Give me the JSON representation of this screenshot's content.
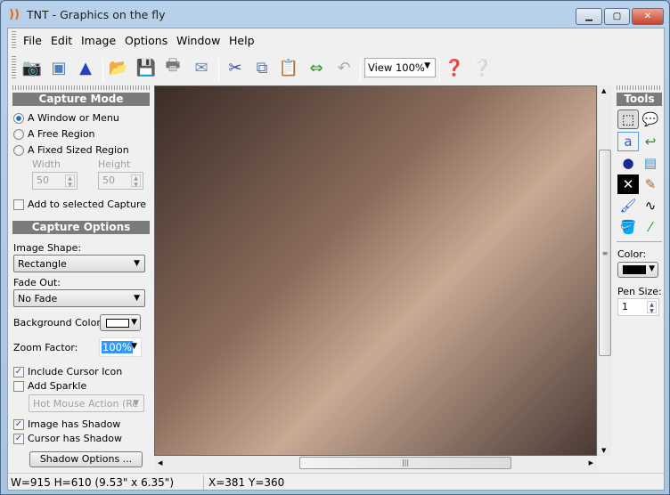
{
  "window": {
    "title": "TNT - Graphics on the fly",
    "minimize": "▁",
    "maximize": "▢",
    "close": "✕"
  },
  "menu": [
    "File",
    "Edit",
    "Image",
    "Options",
    "Window",
    "Help"
  ],
  "toolbar": {
    "view": "View 100%",
    "icons": [
      "camera-icon",
      "window-capture-icon",
      "sparkle-icon",
      "open-folder-icon",
      "save-icon",
      "print-icon",
      "email-icon",
      "cut-icon",
      "copy-icon",
      "paste-icon",
      "resize-icon",
      "undo-icon",
      "help-pointer-icon",
      "help-icon"
    ]
  },
  "capture_mode": {
    "header": "Capture Mode",
    "options": [
      "A Window or Menu",
      "A Free Region",
      "A Fixed Sized Region"
    ],
    "selected": 0,
    "width_label": "Width",
    "height_label": "Height",
    "width": "50",
    "height": "50",
    "add_to_selected": "Add to selected Capture",
    "add_to_selected_checked": false
  },
  "capture_options": {
    "header": "Capture Options",
    "image_shape_label": "Image Shape:",
    "image_shape": "Rectangle",
    "fade_out_label": "Fade Out:",
    "fade_out": "No Fade",
    "bg_color_label": "Background Color:",
    "bg_color": "#ffffff",
    "zoom_label": "Zoom Factor:",
    "zoom": "100%",
    "include_cursor": "Include Cursor Icon",
    "include_cursor_checked": true,
    "add_sparkle": "Add Sparkle",
    "add_sparkle_checked": false,
    "sparkle_action": "Hot Mouse Action (Re",
    "image_shadow": "Image has Shadow",
    "image_shadow_checked": true,
    "cursor_shadow": "Cursor has Shadow",
    "cursor_shadow_checked": true,
    "shadow_options": "Shadow Options ..."
  },
  "tools": {
    "header": "Tools",
    "items": [
      "select-rect-icon",
      "callout-icon",
      "text-icon",
      "arrow-icon",
      "shapes-icon",
      "image-icon",
      "cross-icon",
      "pencil-icon",
      "paintbrush-icon",
      "freehand-icon",
      "fill-bucket-icon",
      "eyedropper-icon"
    ],
    "color_label": "Color:",
    "color": "#000000",
    "pen_size_label": "Pen Size:",
    "pen_size": "1"
  },
  "status": {
    "dims": "W=915  H=610  (9.53\" x 6.35\")",
    "coords": "X=381  Y=360"
  }
}
